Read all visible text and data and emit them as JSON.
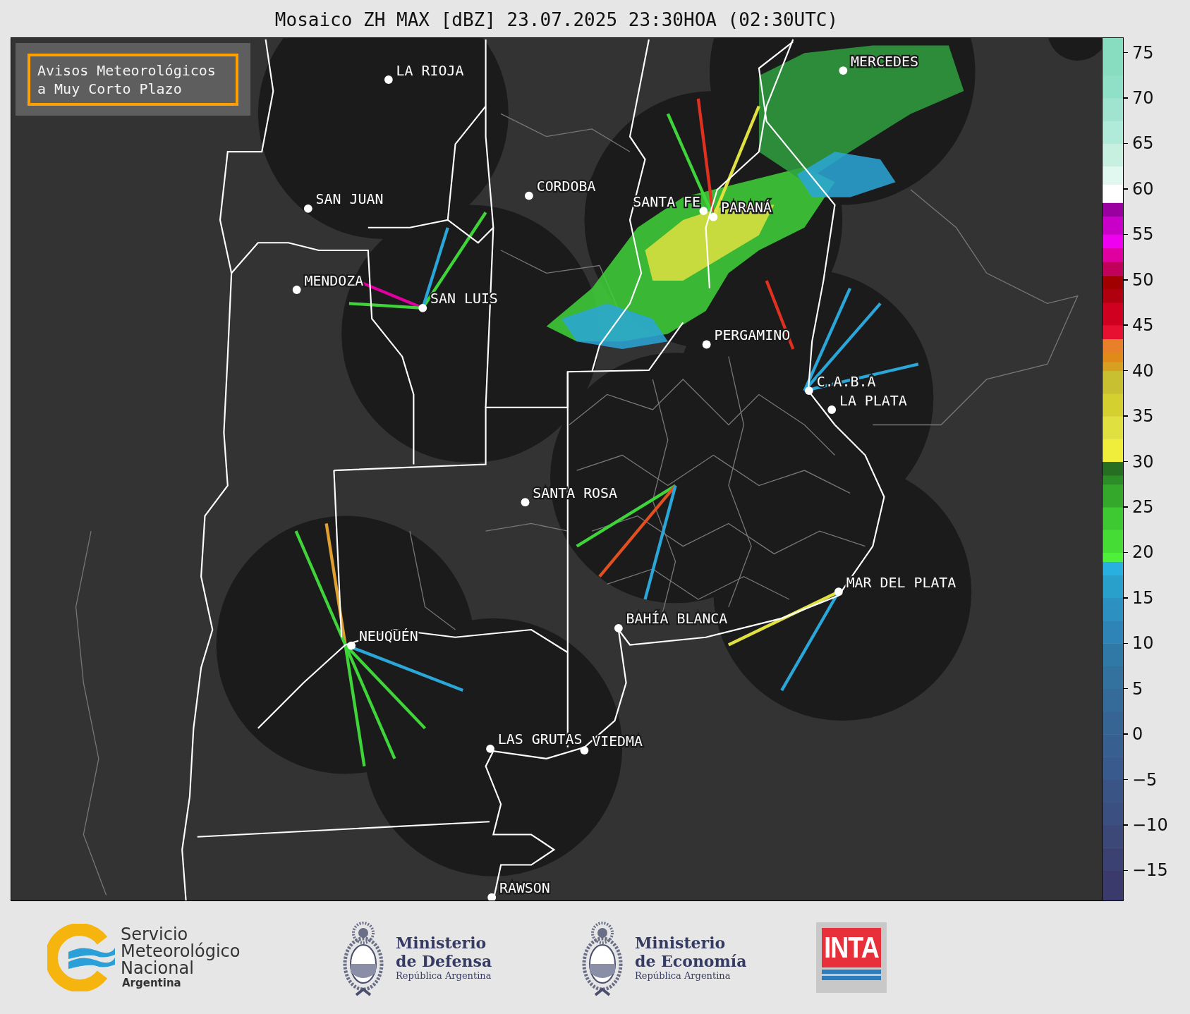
{
  "title": "Mosaico ZH MAX [dBZ] 23.07.2025 23:30HOA (02:30UTC)",
  "notice": {
    "lines": [
      "Avisos Meteorológicos",
      "a Muy Corto Plazo"
    ]
  },
  "cities": [
    {
      "name": "LA RIOJA"
    },
    {
      "name": "MERCEDES"
    },
    {
      "name": "CORDOBA"
    },
    {
      "name": "SAN JUAN"
    },
    {
      "name": "SANTA FE"
    },
    {
      "name": "PARANÁ"
    },
    {
      "name": "MENDOZA"
    },
    {
      "name": "SAN LUIS"
    },
    {
      "name": "PERGAMINO"
    },
    {
      "name": "C.A.B.A"
    },
    {
      "name": "LA PLATA"
    },
    {
      "name": "SANTA ROSA"
    },
    {
      "name": "MAR DEL PLATA"
    },
    {
      "name": "BAHÍA BLANCA"
    },
    {
      "name": "NEUQUÉN"
    },
    {
      "name": "LAS GRUTAS"
    },
    {
      "name": "VIEDMA"
    },
    {
      "name": "RAWSON"
    }
  ],
  "colorbar": {
    "ticks": [
      "75",
      "70",
      "65",
      "60",
      "55",
      "50",
      "45",
      "40",
      "35",
      "30",
      "25",
      "20",
      "15",
      "10",
      "5",
      "0",
      "−5",
      "−10",
      "−15"
    ]
  },
  "footer": {
    "smn": {
      "lines": [
        "Servicio",
        "Meteorológico",
        "Nacional"
      ],
      "country": "Argentina"
    },
    "ministries": [
      {
        "line1": "Ministerio",
        "line2": "de Defensa",
        "country": "República Argentina"
      },
      {
        "line1": "Ministerio",
        "line2": "de Economía",
        "country": "República Argentina"
      }
    ],
    "inta": {
      "label": "INTA"
    }
  }
}
